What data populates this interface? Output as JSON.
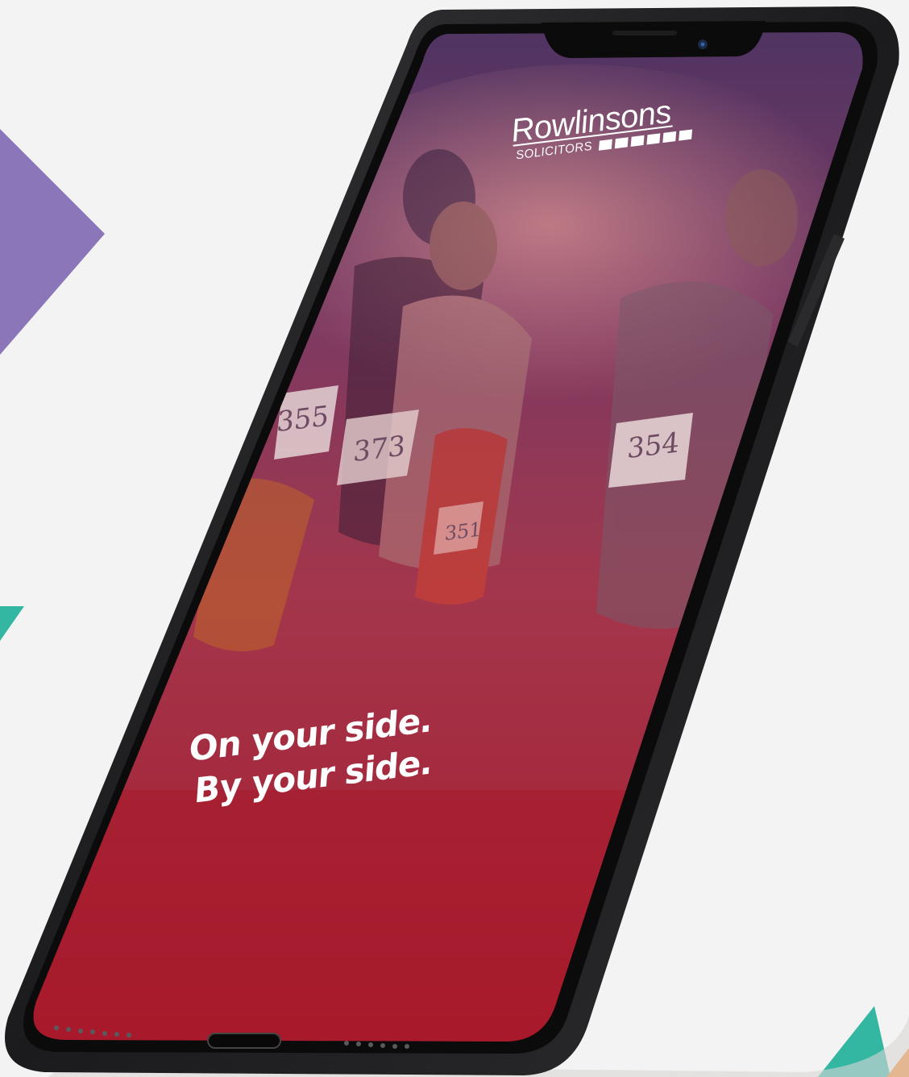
{
  "brand": {
    "name": "Rowlinsons",
    "subtitle": "SOLICITORS"
  },
  "screen": {
    "tagline_line1": "On your side.",
    "tagline_line2": "By your side."
  },
  "bib_numbers": [
    "355",
    "373",
    "354",
    "351"
  ],
  "colors": {
    "background": "#f4f3f3",
    "accent_purple": "#8a76b8",
    "accent_teal": "#33b7a2",
    "accent_orange": "#f28a2e",
    "phone_body": "#1e1e20",
    "screen_top": "#4b3362",
    "screen_bottom": "#a8192a"
  }
}
